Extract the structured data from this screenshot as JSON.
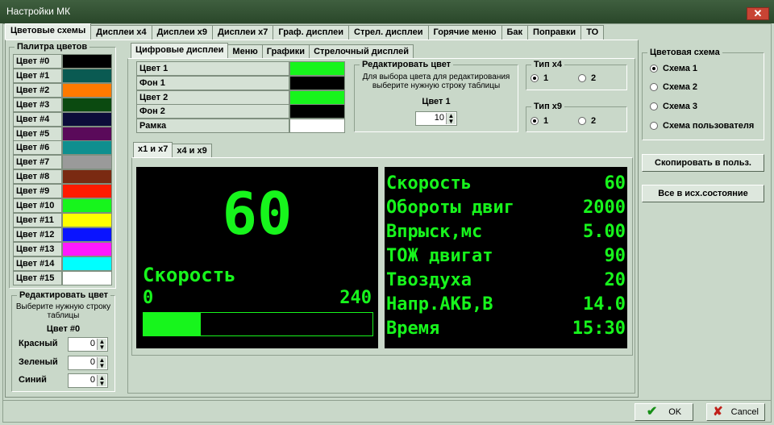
{
  "window": {
    "title": "Настройки МК",
    "close_glyph": "✕"
  },
  "main_tabs": [
    "Цветовые схемы",
    "Дисплеи x4",
    "Дисплеи x9",
    "Дисплеи x7",
    "Граф. дисплеи",
    "Стрел. дисплеи",
    "Горячие меню",
    "Бак",
    "Поправки",
    "ТО"
  ],
  "palette": {
    "title": "Палитра цветов",
    "items": [
      {
        "label": "Цвет #0",
        "color": "#000000"
      },
      {
        "label": "Цвет #1",
        "color": "#0a5a52"
      },
      {
        "label": "Цвет #2",
        "color": "#ff7a00"
      },
      {
        "label": "Цвет #3",
        "color": "#0b4a10"
      },
      {
        "label": "Цвет #4",
        "color": "#0c0c3a"
      },
      {
        "label": "Цвет #5",
        "color": "#5a0a5a"
      },
      {
        "label": "Цвет #6",
        "color": "#0f8f8f"
      },
      {
        "label": "Цвет #7",
        "color": "#9a9a9a"
      },
      {
        "label": "Цвет #8",
        "color": "#7a2a12"
      },
      {
        "label": "Цвет #9",
        "color": "#ff1a00"
      },
      {
        "label": "Цвет #10",
        "color": "#17f51c"
      },
      {
        "label": "Цвет #11",
        "color": "#ffff00"
      },
      {
        "label": "Цвет #12",
        "color": "#0a14ff"
      },
      {
        "label": "Цвет #13",
        "color": "#ff18ff"
      },
      {
        "label": "Цвет #14",
        "color": "#00ffff"
      },
      {
        "label": "Цвет #15",
        "color": "#ffffff"
      }
    ]
  },
  "edit_left": {
    "title": "Редактировать цвет",
    "hint": "Выберите нужную строку таблицы",
    "current": "Цвет #0",
    "red_label": "Красный",
    "red_value": "0",
    "green_label": "Зеленый",
    "green_value": "0",
    "blue_label": "Синий",
    "blue_value": "0"
  },
  "sub_tabs": [
    "Цифровые дисплеи",
    "Меню",
    "Графики",
    "Стрелочный дисплей"
  ],
  "color_table": [
    {
      "label": "Цвет 1",
      "color": "#17f51c"
    },
    {
      "label": "Фон 1",
      "color": "#000000"
    },
    {
      "label": "Цвет 2",
      "color": "#17f51c"
    },
    {
      "label": "Фон 2",
      "color": "#000000"
    },
    {
      "label": "Рамка",
      "color": "#ffffff"
    }
  ],
  "edit_right": {
    "title": "Редактировать цвет",
    "hint": "Для выбора цвета для редактирования выберите нужную строку таблицы",
    "current": "Цвет 1",
    "value": "10"
  },
  "type_x4": {
    "title": "Тип x4",
    "opt1": "1",
    "opt2": "2",
    "selected": 1
  },
  "type_x9": {
    "title": "Тип x9",
    "opt1": "1",
    "opt2": "2",
    "selected": 1
  },
  "preview_tabs": [
    "x1 и x7",
    "x4 и x9"
  ],
  "preview_x1": {
    "big_value": "60",
    "label": "Скорость",
    "min": "0",
    "max": "240",
    "progress": 0.25
  },
  "preview_x9": [
    {
      "k": "Скорость",
      "v": "60"
    },
    {
      "k": "Обороты двиг",
      "v": "2000"
    },
    {
      "k": "Впрыск,мс",
      "v": "5.00"
    },
    {
      "k": "ТОЖ двигат",
      "v": "90"
    },
    {
      "k": "Твоздуха",
      "v": "20"
    },
    {
      "k": "Напр.АКБ,В",
      "v": "14.0"
    },
    {
      "k": "Время",
      "v": "15:30"
    }
  ],
  "scheme": {
    "title": "Цветовая схема",
    "options": [
      "Схема 1",
      "Схема 2",
      "Схема 3",
      "Схема пользователя"
    ],
    "selected": 0,
    "copy_btn": "Скопировать в польз.",
    "reset_btn": "Все в исх.состояние"
  },
  "footer": {
    "ok": "OK",
    "cancel": "Cancel"
  },
  "colors": {
    "lcd_green": "#17f51c",
    "bg": "#c9d8c9"
  }
}
